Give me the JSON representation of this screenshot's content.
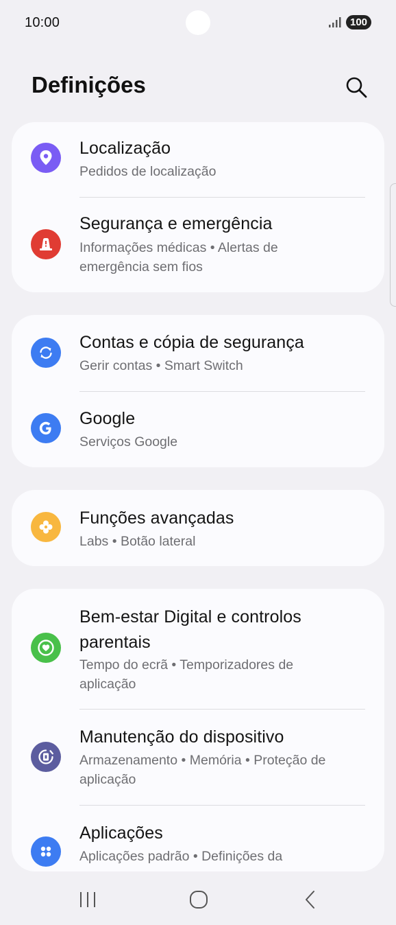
{
  "status_bar": {
    "time": "10:00",
    "battery": "100",
    "icons": [
      "front-camera-cutout",
      "signal-icon",
      "battery-icon"
    ]
  },
  "header": {
    "title": "Definições",
    "search_icon": "search-icon"
  },
  "colors": {
    "background": "#f1f0f4",
    "card": "#fbfbfe",
    "location": "#7a5cf4",
    "safety": "#e03c33",
    "accounts": "#3d7cf2",
    "google": "#3d7cf2",
    "advanced": "#f8b73f",
    "wellbeing": "#49c04a",
    "device_care": "#5c5d9f",
    "apps": "#3d7cf2"
  },
  "settings": {
    "location": {
      "icon": "location-pin-icon",
      "title": "Localização",
      "subtitle": "Pedidos de localização"
    },
    "safety": {
      "icon": "emergency-light-icon",
      "title": "Segurança e emergência",
      "subtitle_line1": "Informações médicas  •  Alertas de",
      "subtitle_line2": "emergência sem fios"
    },
    "accounts": {
      "icon": "sync-icon",
      "title": "Contas e cópia de segurança",
      "subtitle": "Gerir contas  •  Smart Switch"
    },
    "google": {
      "icon": "google-g-icon",
      "title": "Google",
      "subtitle": "Serviços Google"
    },
    "advanced": {
      "icon": "gear-flower-icon",
      "title": "Funções avançadas",
      "subtitle": "Labs  •  Botão lateral"
    },
    "wellbeing": {
      "icon": "wellbeing-heart-icon",
      "title_line1": "Bem-estar Digital e controlos",
      "title_line2": "parentais",
      "subtitle_line1": "Tempo do ecrã  •  Temporizadores de",
      "subtitle_line2": "aplicação"
    },
    "device_care": {
      "icon": "device-care-icon",
      "title": "Manutenção do dispositivo",
      "subtitle_line1": "Armazenamento  •  Memória  •  Proteção de",
      "subtitle_line2": "aplicação"
    },
    "apps": {
      "icon": "apps-grid-icon",
      "title": "Aplicações",
      "subtitle_line1": "Aplicações padrão  •  Definições da"
    }
  },
  "nav_bar": {
    "recents_icon": "recents-icon",
    "home_icon": "home-icon",
    "back_icon": "back-icon"
  }
}
